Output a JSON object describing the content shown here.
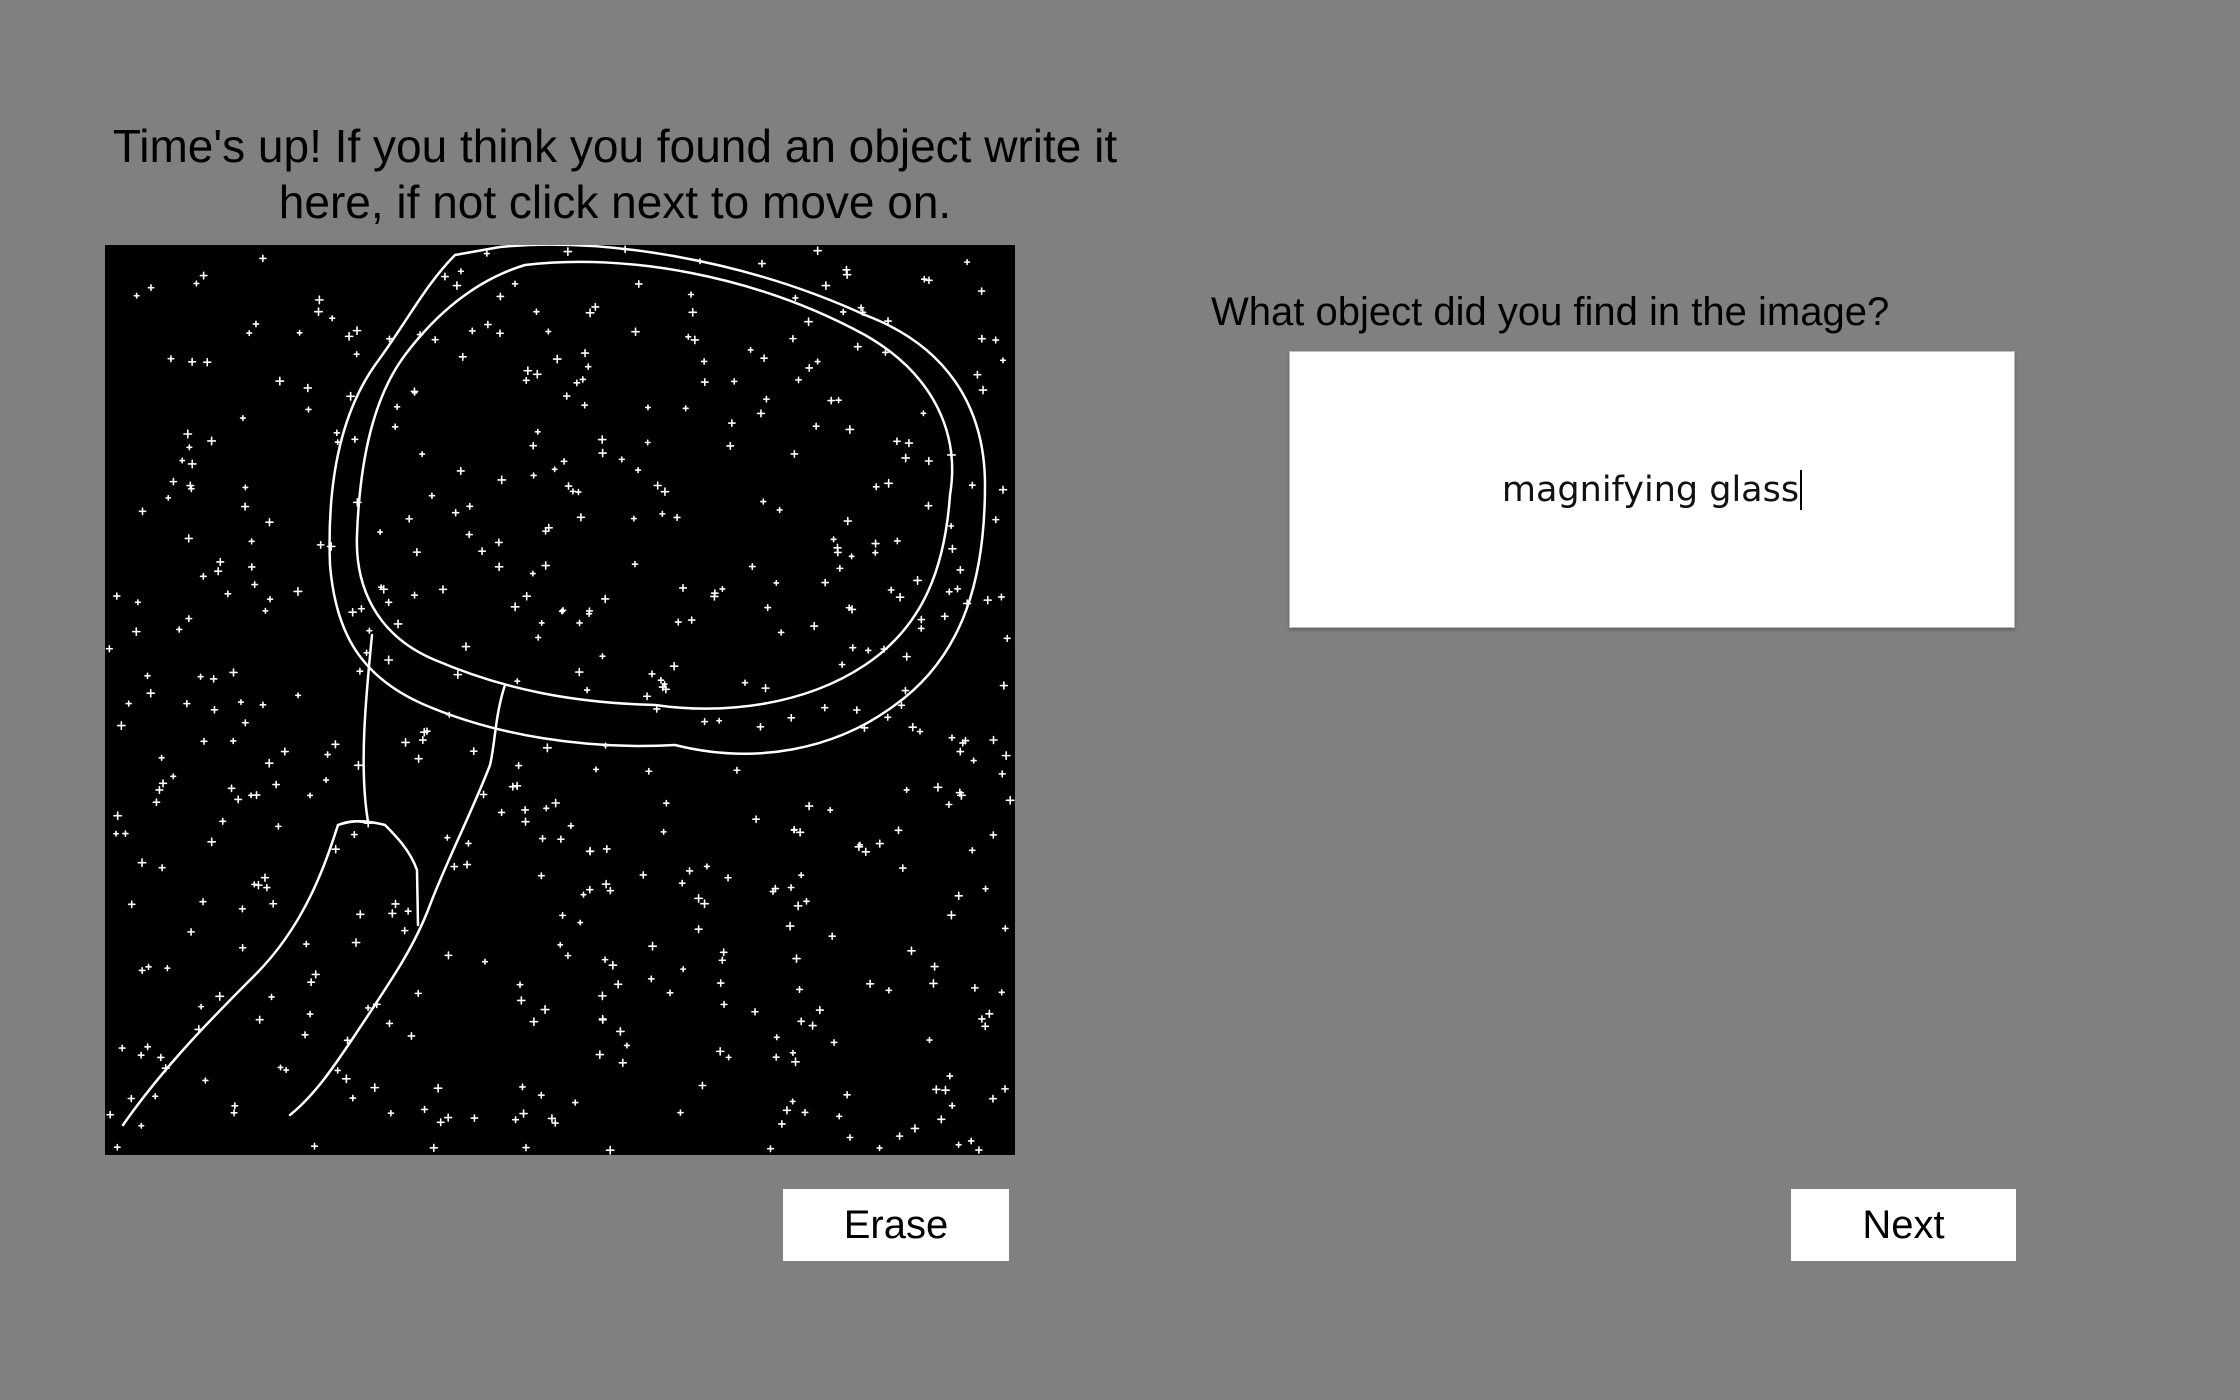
{
  "instruction": {
    "line1": "Time's up! If you think you found an object write it",
    "line2": "here, if not click next to move on."
  },
  "stimulus": {
    "background_color": "#000000",
    "dot_color": "#ffffff",
    "drawing_color": "#ffffff"
  },
  "question": {
    "text": "What object did you find in the image?"
  },
  "answer": {
    "value": "magnifying glass"
  },
  "buttons": {
    "erase_label": "Erase",
    "next_label": "Next"
  }
}
